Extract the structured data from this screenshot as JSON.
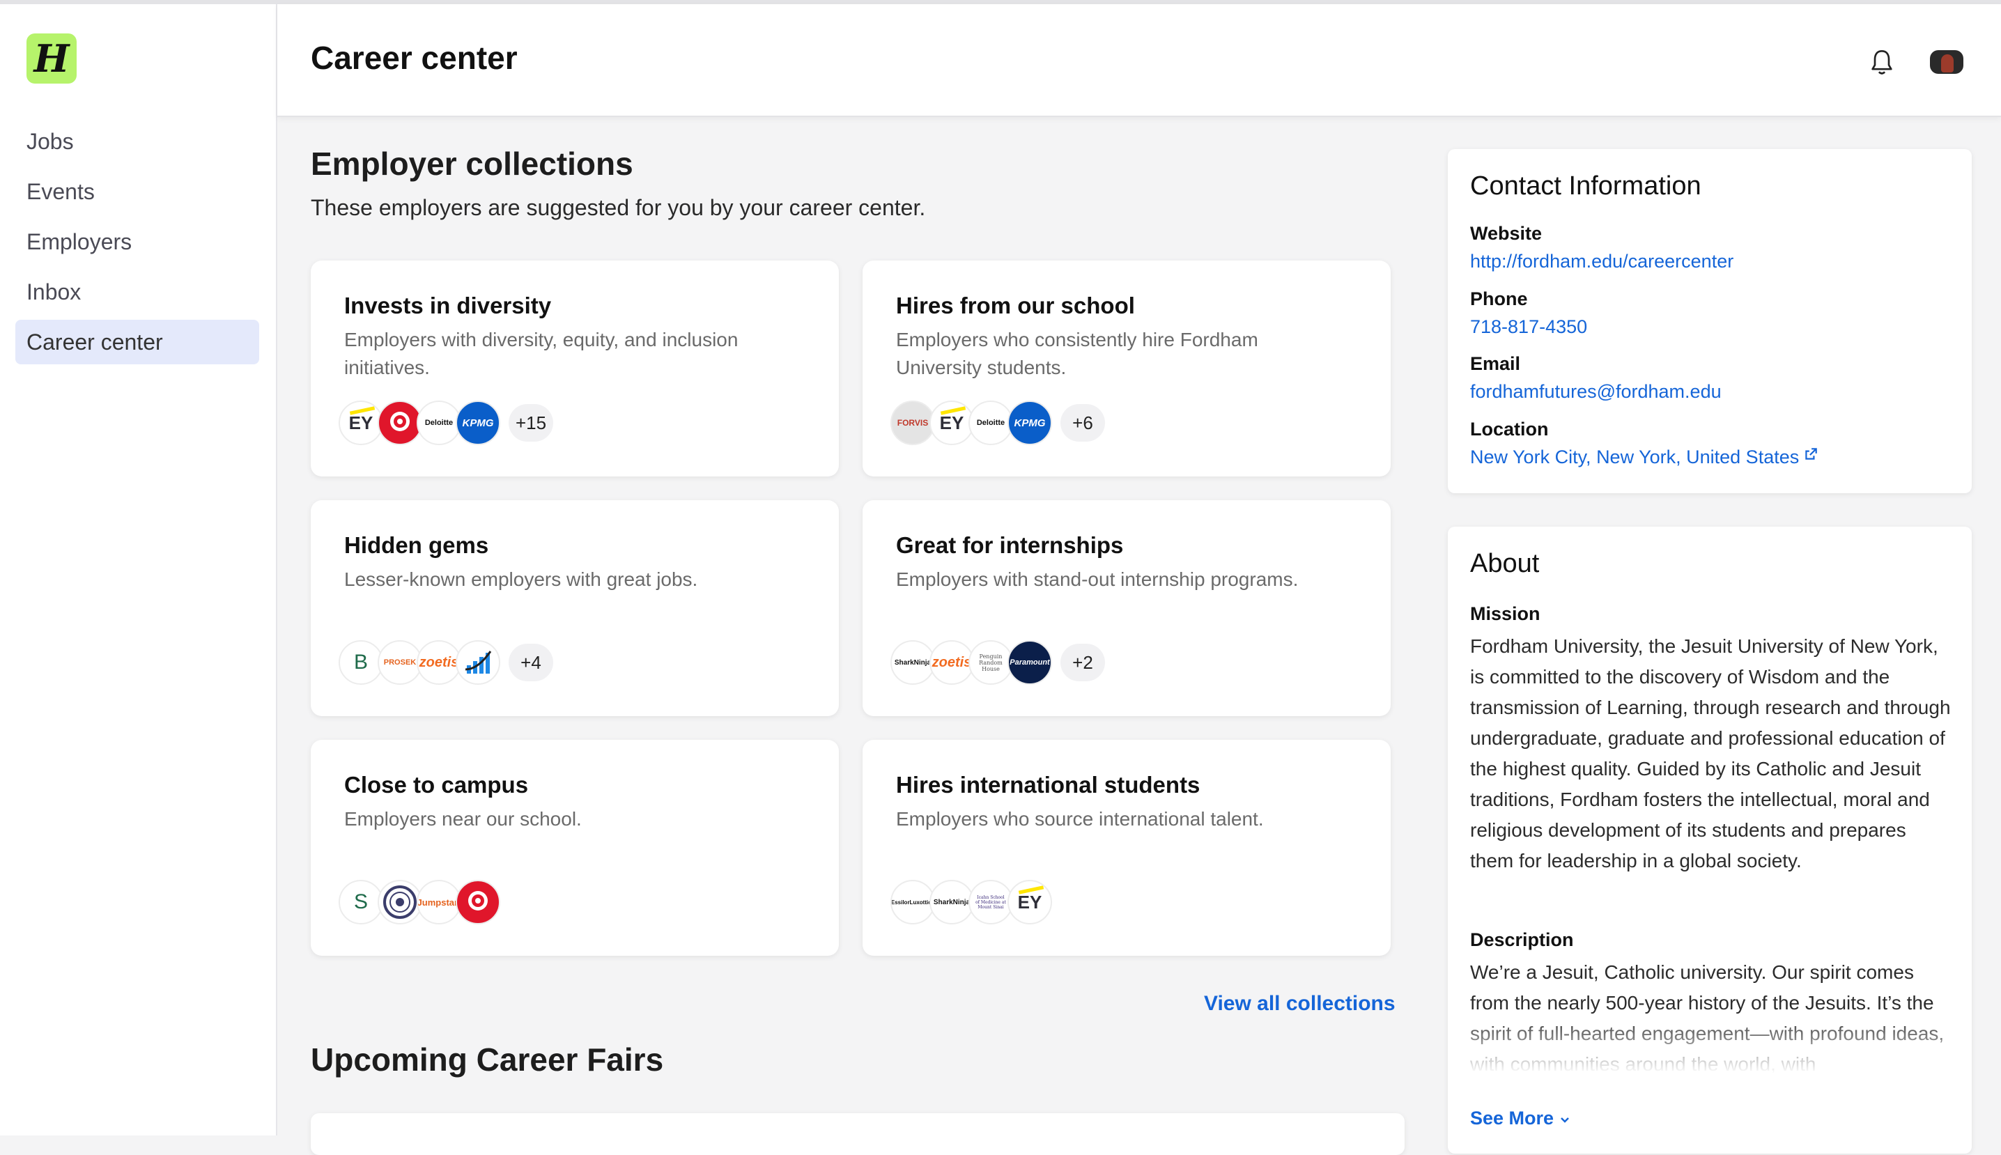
{
  "brand": {
    "logo_letter": "H",
    "accent": "#b6f36b",
    "link_color": "#1565d8"
  },
  "sidebar": {
    "items": [
      {
        "label": "Jobs"
      },
      {
        "label": "Events"
      },
      {
        "label": "Employers"
      },
      {
        "label": "Inbox"
      },
      {
        "label": "Career center",
        "active": true
      }
    ]
  },
  "header": {
    "title": "Career center",
    "icons": [
      "bell-icon",
      "avatar"
    ]
  },
  "collections": {
    "title": "Employer collections",
    "subtitle": "These employers are suggested for you by your career center.",
    "cards": [
      {
        "title": "Invests in diversity",
        "desc": "Employers with diversity, equity, and inclusion initiatives.",
        "logos": [
          "EY",
          "Target",
          "Deloitte",
          "KPMG"
        ],
        "more": "+15"
      },
      {
        "title": "Hires from our school",
        "desc": "Employers who consistently hire Fordham University students.",
        "logos": [
          "FORVIS",
          "EY",
          "Deloitte",
          "KPMG"
        ],
        "more": "+6"
      },
      {
        "title": "Hidden gems",
        "desc": "Lesser-known employers with great jobs.",
        "logos": [
          "B",
          "PROSEK",
          "zoetis",
          "chart"
        ],
        "more": "+4"
      },
      {
        "title": "Great for internships",
        "desc": "Employers with stand-out internship programs.",
        "logos": [
          "SharkNinja",
          "zoetis",
          "Penguin Random House",
          "Paramount"
        ],
        "more": "+2"
      },
      {
        "title": "Close to campus",
        "desc": "Employers near our school.",
        "logos": [
          "S",
          "seal",
          "Jumpstart",
          "Target"
        ],
        "more": ""
      },
      {
        "title": "Hires international students",
        "desc": "Employers who source international talent.",
        "logos": [
          "EssilorLuxottica",
          "SharkNinja",
          "Icahn School of Medicine at Mount Sinai",
          "EY"
        ],
        "more": ""
      }
    ],
    "view_all": "View all collections"
  },
  "fairs": {
    "title": "Upcoming Career Fairs"
  },
  "contact": {
    "title": "Contact Information",
    "website_label": "Website",
    "website": "http://fordham.edu/careercenter",
    "phone_label": "Phone",
    "phone": "718-817-4350",
    "email_label": "Email",
    "email": "fordhamfutures@fordham.edu",
    "location_label": "Location",
    "location": "New York City, New York, United States"
  },
  "about": {
    "title": "About",
    "mission_label": "Mission",
    "mission": "Fordham University, the Jesuit University of New York, is committed to the discovery of Wisdom and the transmission of Learning, through research and through undergraduate, graduate and professional education of the highest quality. Guided by its Catholic and Jesuit traditions, Fordham fosters the intellectual, moral and religious development of its students and prepares them for leadership in a global society.",
    "description_label": "Description",
    "description": "We’re a Jesuit, Catholic university. Our spirit comes from the nearly 500-year history of the Jesuits. It’s the spirit of full-hearted engagement—with profound ideas, with communities around the world, with",
    "see_more": "See More"
  }
}
